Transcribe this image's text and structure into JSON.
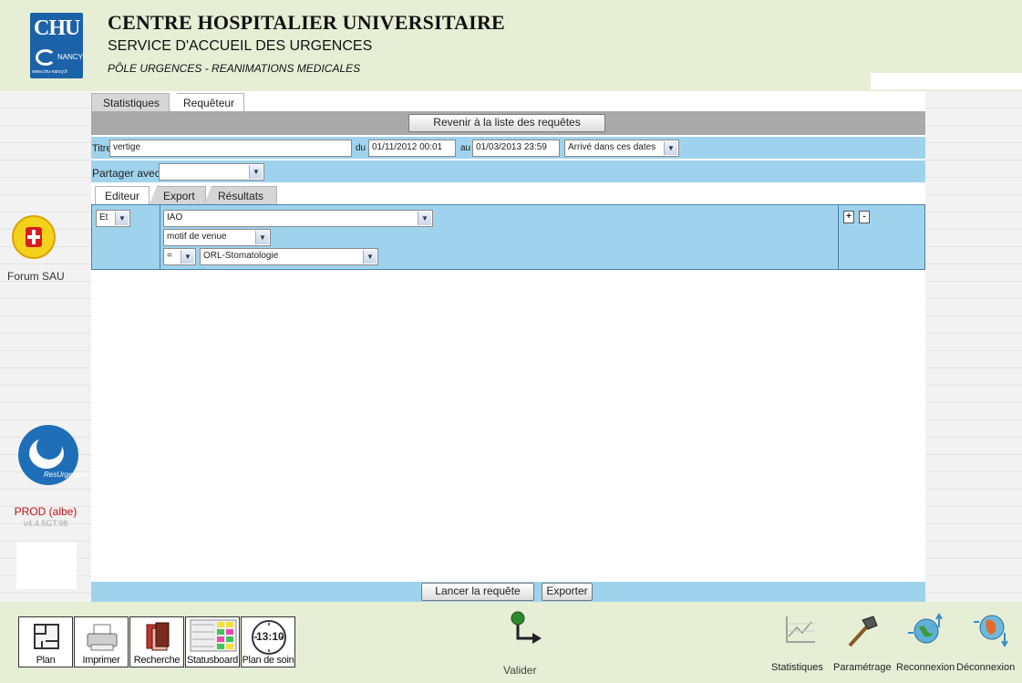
{
  "header": {
    "logo_text": "CHU",
    "logo_sub": "NANCY",
    "logo_url": "www.chu-nancy.fr",
    "title": "CENTRE HOSPITALIER UNIVERSITAIRE",
    "subtitle": "SERVICE D'ACCUEIL DES URGENCES",
    "pole": "PÔLE URGENCES - REANIMATIONS MEDICALES"
  },
  "sidebar": {
    "forum_label": "Forum SAU",
    "env_label": "PROD (albe)",
    "version": "v4.4.5GT.98",
    "resurgences_word": "ResUrgences"
  },
  "top_tabs": [
    {
      "label": "Statistiques"
    },
    {
      "label": "Requêteur"
    }
  ],
  "back_button": "Revenir à la liste des requêtes",
  "query": {
    "title_label": "Titre",
    "title_value": "vertige",
    "from_label": "du",
    "from_value": "01/11/2012 00:01",
    "to_label": "au",
    "to_value": "01/03/2013 23:59",
    "date_mode": "Arrivé dans ces dates",
    "share_label": "Partager avec:",
    "share_value": ""
  },
  "sub_tabs": [
    {
      "label": "Editeur"
    },
    {
      "label": "Export"
    },
    {
      "label": "Résultats"
    }
  ],
  "editor": {
    "operator": "Et",
    "field": "IAO",
    "subfield": "motif de venue",
    "comparator": "=",
    "value": "ORL-Stomatologie",
    "add_label": "+",
    "remove_label": "-"
  },
  "actions": {
    "run": "Lancer la requête",
    "export": "Exporter"
  },
  "footer": {
    "left_buttons": [
      {
        "label": "Plan"
      },
      {
        "label": "Imprimer"
      },
      {
        "label": "Recherche"
      },
      {
        "label": "Statusboard"
      },
      {
        "label": "Plan de soin",
        "clock": "13:10"
      }
    ],
    "validate": "Valider",
    "right_buttons": [
      {
        "label": "Statistiques"
      },
      {
        "label": "Paramétrage"
      },
      {
        "label": "Reconnexion"
      },
      {
        "label": "Déconnexion"
      }
    ]
  }
}
